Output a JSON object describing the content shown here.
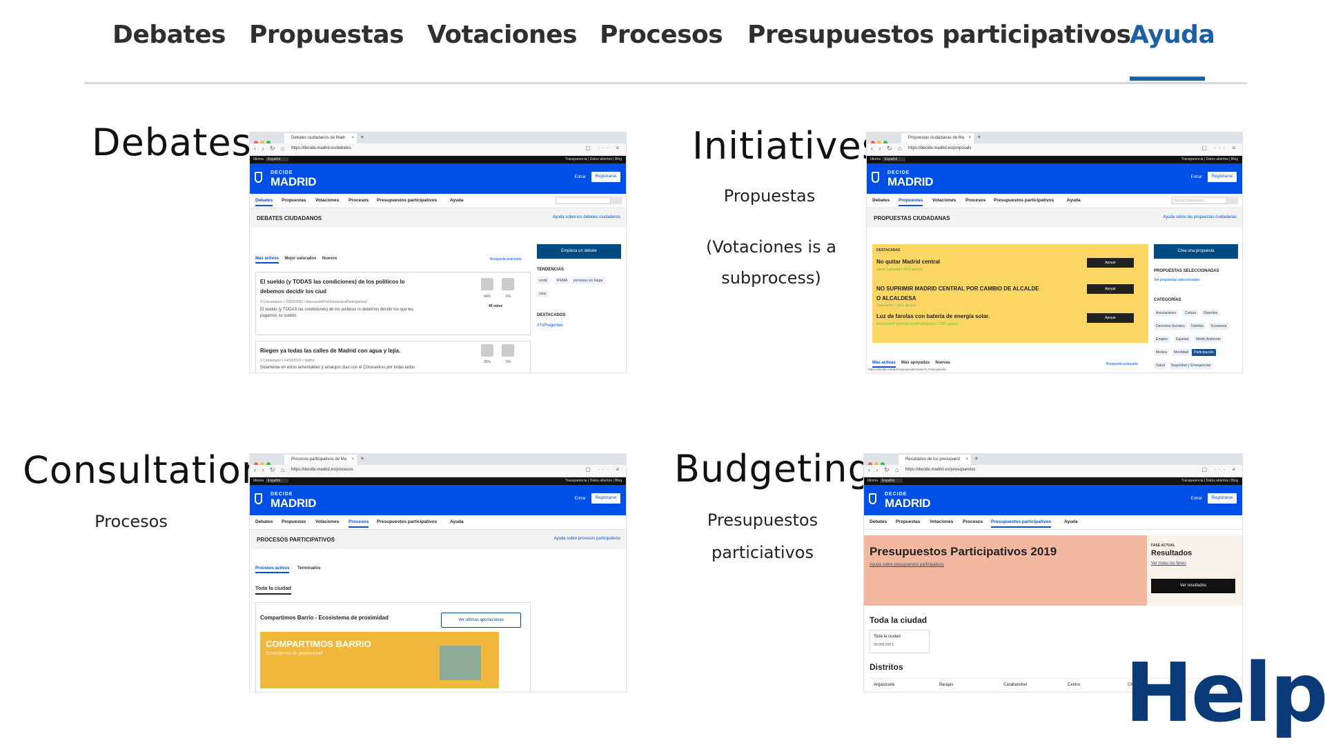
{
  "nav": {
    "tabs": [
      {
        "label": "Debates"
      },
      {
        "label": "Propuestas"
      },
      {
        "label": "Votaciones"
      },
      {
        "label": "Procesos"
      },
      {
        "label": "Presupuestos participativos"
      },
      {
        "label": "Ayuda"
      }
    ],
    "active_tab": "Ayuda"
  },
  "quadrants": {
    "debates": {
      "title": "Debates"
    },
    "initiatives": {
      "title": "Initiatives",
      "sub1": "Propuestas",
      "sub2": "(Votaciones is a",
      "sub3": "subprocess)"
    },
    "consultation": {
      "title": "Consultation",
      "sub1": "Procesos"
    },
    "budgeting": {
      "title": "Budgeting",
      "sub1": "Presupuestos",
      "sub2": "particiativos"
    }
  },
  "common": {
    "idioma": "Idioma",
    "lang": "Español",
    "toplinks": "Transparencia  |  Datos abiertos  |  Blog",
    "brand_small": "DECIDE",
    "brand_big": "MADRID",
    "entrar": "Entrar",
    "registrarse": "Registrarse",
    "menu": [
      "Debates",
      "Propuestas",
      "Votaciones",
      "Procesos",
      "Presupuestos participativos",
      "Ayuda"
    ]
  },
  "shot_debates": {
    "tab_title": "Debates ciudadanos de Madr",
    "url": "https://decide.madrid.es/debates",
    "section": "DEBATES CIUDADANOS",
    "help": "Ayuda sobre los debates ciudadanos",
    "sort": [
      "Más activos",
      "Mejor valorados",
      "Nuevos"
    ],
    "advanced": "Búsqueda avanzada",
    "button": "Empieza un debate",
    "tendencias": "TENDENCIAS",
    "tags": [
      "covid",
      "IFEMA",
      "personas sin hogar",
      "virus"
    ],
    "destacados": "DESTACADOS",
    "hashtag": "#TúPreguntas",
    "card1": {
      "title1": "El sueldo (y TODAS las condiciones) de los políticos lo",
      "title2": "debemos decidir los ciud",
      "meta": "3 Comentarios • 20/03/2020 • AsociaciónProDemocraciaParticipativa2",
      "desc1": "El sueldo (y TODAS las condiciones) de los políticos lo debemos decidir los que les",
      "desc2": "pagamos su sueldo.",
      "yes": "94%",
      "no": "6%",
      "votes": "49 votos"
    },
    "card2": {
      "title": "Riegen ya todas las calles de Madrid con agua y lejía.",
      "meta": "1 Comentario • 24/03/2020 • Sisifez",
      "desc": "Solamente en estos lamentables y amargos días con el Coronavirus por todas lados",
      "yes": "95%",
      "no": "5%"
    }
  },
  "shot_propuestas": {
    "tab_title": "Propuestas ciudadanas de Ma",
    "url": "https://decide.madrid.es/proposals",
    "search_placeholder": "Buscar propuestas...",
    "section": "PROPUESTAS CIUDADANAS",
    "help": "Ayuda sobre las propuestas ciudadanas",
    "destacadas": "DESTACADAS",
    "items": [
      {
        "title": "No quitar Madrid central",
        "sub": "Javier Lahuerta • 3079 apoyos",
        "btn": "Apoyar"
      },
      {
        "title": "NO SUPRIMIR MADRID CENTRAL POR CAMBIO DE ALCALDE",
        "title2": "O ALCALDESA",
        "sub": "Juancarlier • 1671 apoyos",
        "btn": "Apoyar"
      },
      {
        "title": "Luz de farolas con batería de energía solar.",
        "sub": "AsociaciónProDemocraciaParticipativa • 1321 apoyos",
        "btn": "Apoyar"
      }
    ],
    "button": "Crea una propuesta",
    "selected_h": "PROPUESTAS SELECCIONADAS",
    "selected_link": "Ver propuestas seleccionadas",
    "categorias": "CATEGORÍAS",
    "cats": [
      "Asociaciones",
      "Cultura",
      "Deportes",
      "Derechos Sociales",
      "Distritos",
      "Economía",
      "Empleo",
      "Equidad",
      "Medio Ambiente",
      "Medios",
      "Movilidad",
      "Participación",
      "Salud",
      "Seguridad y Emergencias"
    ],
    "sort": [
      "Más activas",
      "Más apoyadas",
      "Nuevas"
    ],
    "advanced": "Búsqueda avanzada",
    "status_url": "https://decide.madrid.es/proposals?search=Participación"
  },
  "shot_procesos": {
    "tab_title": "Procesos participativos de Ma",
    "url": "https://decide.madrid.es/procesos",
    "section": "PROCESOS PARTICIPATIVOS",
    "help": "Ayuda sobre procesos participativos",
    "tabs": [
      "Procesos activos",
      "Terminados"
    ],
    "toda": "Toda la ciudad",
    "card_title": "Compartimos Barrio - Ecosistema de proximidad",
    "card_btn": "Ver últimas aportaciones",
    "banner_title": "COMPARTIMOS BARRIO",
    "banner_sub": "Ecosistema de proximidad"
  },
  "shot_presupuestos": {
    "tab_title": "Resultados de los presupuest",
    "url": "https://decide.madrid.es/presupuestos",
    "banner_title": "Presupuestos Participativos 2019",
    "banner_link": "Ayuda sobre presupuestos participativos",
    "fase": "FASE ACTUAL",
    "resultados": "Resultados",
    "fases_link": "Ver todas las fases",
    "ver_resultados": "Ver resultados",
    "toda": "Toda la ciudad",
    "box_label": "Toda la ciudad",
    "box_amount": "30.000.000 €",
    "distritos": "Distritos",
    "district_names": [
      "Arganzuela",
      "Barajas",
      "Carabanchel",
      "Centro",
      "Ch"
    ]
  },
  "help_logo": "Help",
  "colors": {
    "accent": "#1c5fa5",
    "madrid_blue": "#0050e8",
    "help": "#0b3a78"
  }
}
